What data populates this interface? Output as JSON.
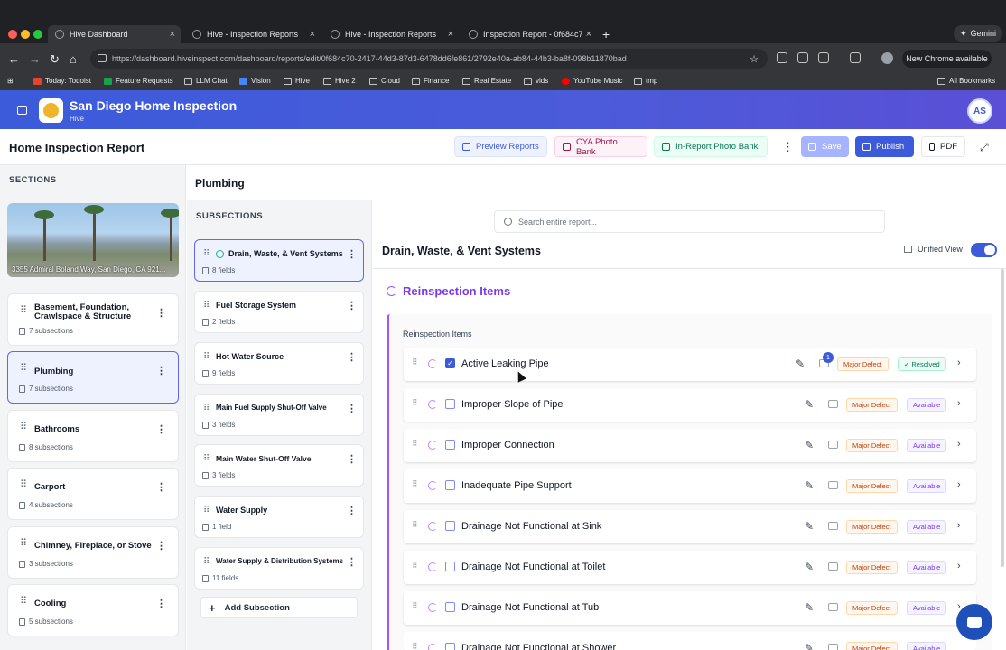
{
  "browser": {
    "tabs": [
      {
        "label": "Hive Dashboard"
      },
      {
        "label": "Hive - Inspection Reports"
      },
      {
        "label": "Hive - Inspection Reports"
      },
      {
        "label": "Inspection Report - 0f684c70..."
      }
    ],
    "gemini_label": "Gemini",
    "url": "https://dashboard.hiveinspect.com/dashboard/reports/edit/0f684c70-2417-44d3-87d3-6478dd6fe861/2792e40a-ab84-44b3-ba8f-098b11870bad",
    "new_chrome_label": "New Chrome available",
    "bookmarks": [
      {
        "label": "Today: Todoist"
      },
      {
        "label": "Feature Requests"
      },
      {
        "label": "LLM Chat"
      },
      {
        "label": "Vision"
      },
      {
        "label": "Hive"
      },
      {
        "label": "Hive 2"
      },
      {
        "label": "Cloud"
      },
      {
        "label": "Finance"
      },
      {
        "label": "Real Estate"
      },
      {
        "label": "vids"
      },
      {
        "label": "YouTube Music"
      },
      {
        "label": "tmp"
      }
    ],
    "all_bookmarks_label": "All Bookmarks"
  },
  "app": {
    "title": "San Diego Home Inspection",
    "subtitle": "Hive",
    "user_initials": "AS"
  },
  "toolbar": {
    "report_title": "Home Inspection Report",
    "preview_label": "Preview Reports",
    "cya_label": "CYA Photo Bank",
    "inreport_label": "In-Report Photo Bank",
    "save_label": "Save",
    "publish_label": "Publish",
    "pdf_label": "PDF"
  },
  "sections": {
    "heading": "SECTIONS",
    "address": "3355 Admiral Boland Way, San Diego, CA 921...",
    "items": [
      {
        "name": "Basement, Foundation, Crawlspace & Structure",
        "count": "7 subsections"
      },
      {
        "name": "Plumbing",
        "count": "7 subsections"
      },
      {
        "name": "Bathrooms",
        "count": "8 subsections"
      },
      {
        "name": "Carport",
        "count": "4 subsections"
      },
      {
        "name": "Chimney, Fireplace, or Stove",
        "count": "3 subsections"
      },
      {
        "name": "Cooling",
        "count": "5 subsections"
      }
    ]
  },
  "subsections": {
    "section_title": "Plumbing",
    "heading": "SUBSECTIONS",
    "items": [
      {
        "name": "Drain, Waste, & Vent Systems",
        "fields": "8 fields"
      },
      {
        "name": "Fuel Storage System",
        "fields": "2 fields"
      },
      {
        "name": "Hot Water Source",
        "fields": "9 fields"
      },
      {
        "name": "Main Fuel Supply Shut-Off Valve",
        "fields": "3 fields"
      },
      {
        "name": "Main Water Shut-Off Valve",
        "fields": "3 fields"
      },
      {
        "name": "Water Supply",
        "fields": "1 field"
      },
      {
        "name": "Water Supply & Distribution Systems",
        "fields": "11 fields"
      }
    ],
    "add_label": "Add Subsection"
  },
  "main": {
    "search_placeholder": "Search entire report...",
    "subsection_title": "Drain, Waste, & Vent Systems",
    "unified_view_label": "Unified View",
    "reinspection_title": "Reinspection Items",
    "reinspection_label": "Reinspection Items",
    "items": [
      {
        "name": "Active Leaking Pipe",
        "defect": "Major Defect",
        "status": "✓ Resolved",
        "photo_count": "1"
      },
      {
        "name": "Improper Slope of Pipe",
        "defect": "Major Defect",
        "status": "Available"
      },
      {
        "name": "Improper Connection",
        "defect": "Major Defect",
        "status": "Available"
      },
      {
        "name": "Inadequate Pipe Support",
        "defect": "Major Defect",
        "status": "Available"
      },
      {
        "name": "Drainage Not Functional at Sink",
        "defect": "Major Defect",
        "status": "Available"
      },
      {
        "name": "Drainage Not Functional at Toilet",
        "defect": "Major Defect",
        "status": "Available"
      },
      {
        "name": "Drainage Not Functional at Tub",
        "defect": "Major Defect",
        "status": "Available"
      },
      {
        "name": "Drainage Not Functional at Shower",
        "defect": "Major Defect",
        "status": "Available"
      }
    ]
  },
  "colors": {
    "brand": "#3b5bdb",
    "reinspection_accent": "#a855f7",
    "defect": "#c2410c",
    "resolved": "#047857"
  }
}
